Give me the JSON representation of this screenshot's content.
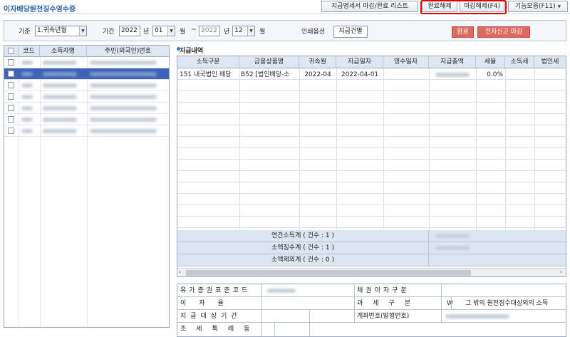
{
  "window": {
    "title": "이자배당원천징수영수증"
  },
  "toolbar": {
    "list_button": "지급명세서 마감/완료 리스트",
    "complete_cancel_button": "완료해제",
    "close_cancel_button": "마감해제(F4)",
    "functions_button": "기능모음(F11)"
  },
  "filter": {
    "basis_label": "기준",
    "basis_value": "1.귀속년월",
    "period_label": "기간",
    "year_from": "2022",
    "year_unit": "년",
    "month_from": "01",
    "month_unit": "월",
    "range_sep": "~",
    "year_to": "2022",
    "month_to": "12",
    "print_option_label": "인쇄옵션",
    "print_option_button": "지급건별",
    "complete_button": "완료",
    "efile_close_button": "전자신고 마감"
  },
  "left_grid": {
    "columns": [
      "코드",
      "소득자명",
      "주민(외국인)번호"
    ],
    "row_count": 7,
    "selected_row": 1
  },
  "payments": {
    "section_title": "지급내역",
    "columns": [
      "소득구분",
      "금융상품명",
      "귀속월",
      "지급일자",
      "영수일자",
      "지급총액",
      "세율",
      "소득세",
      "법인세"
    ],
    "rows": [
      {
        "income_type": "151 내국법인 배당",
        "product": "B52 [법인배당-소",
        "attr_month": "2022-04",
        "pay_date": "2022-04-01",
        "receipt_date": "",
        "tax_rate": "0.0%"
      }
    ],
    "summary": [
      {
        "label": "연간소득계 ( 건수 : 1 )"
      },
      {
        "label": "소액징수계 ( 건수 : 1 )"
      },
      {
        "label": "소액제외계 ( 건수 : 0 )"
      }
    ]
  },
  "info": {
    "isin_label": "유가증권표준코드",
    "bond_interest_label": "채권이자구분",
    "interest_rate_label": "이자율",
    "tax_class_label": "과세구분",
    "tax_class_code": "W",
    "tax_class_value": "그 밖의 원천징수대상외의 소득",
    "period_label": "지급대상기간",
    "account_label": "계좌번호(발행번호)",
    "treaty_label": "조세특례등"
  },
  "colors": {
    "accent": "#2a62b0",
    "selected_row": "#3f63b8",
    "action_red": "#de6b5f",
    "highlight_box": "#e00000"
  }
}
